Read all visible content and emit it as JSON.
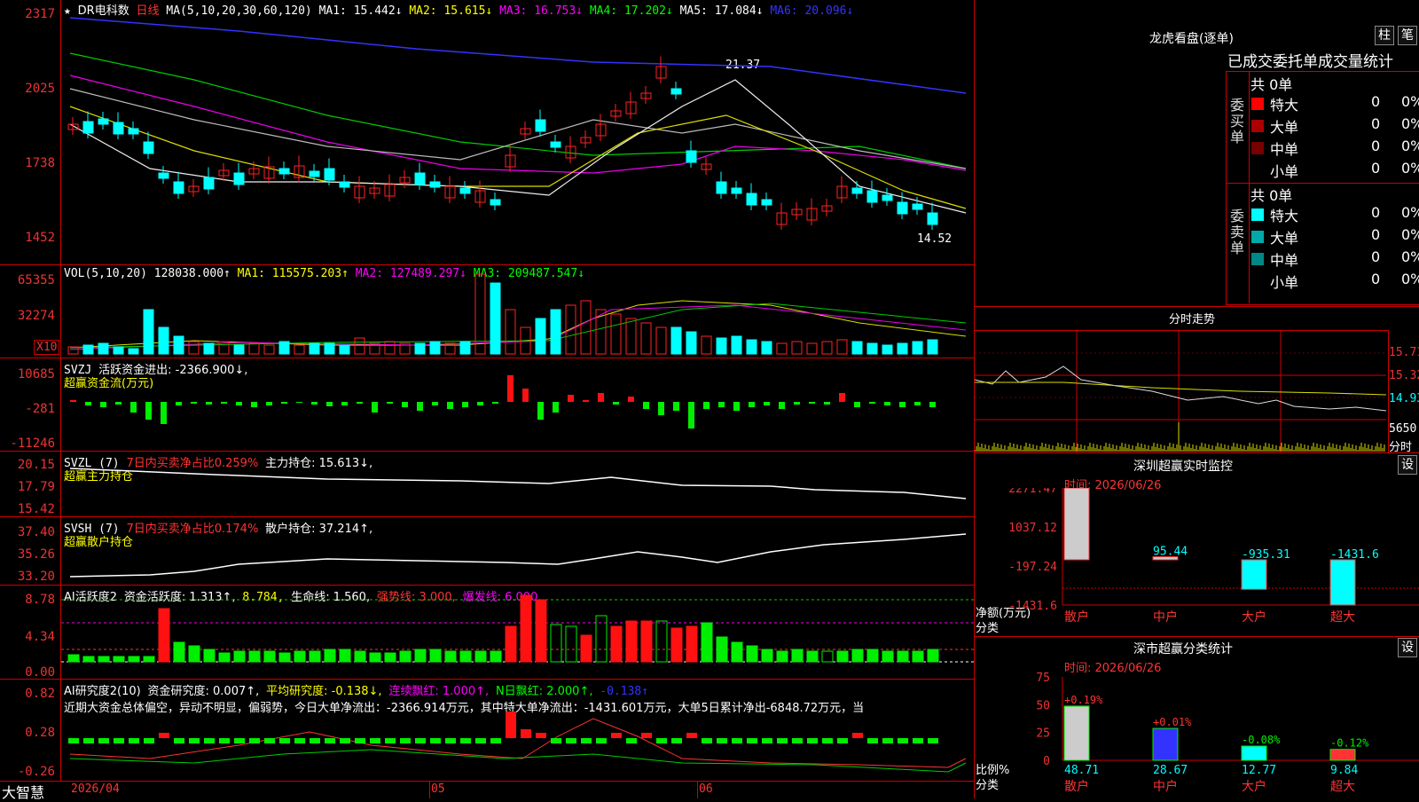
{
  "stock": {
    "name": "DR电科数",
    "period": "日线",
    "star": "★"
  },
  "ma": {
    "label": "MA(5,10,20,30,60,120)",
    "ma1": "MA1: 15.442↓",
    "ma2": "MA2: 15.615↓",
    "ma3": "MA3: 16.753↓",
    "ma4": "MA4: 17.202↓",
    "ma5": "MA5: 17.084↓",
    "ma6": "MA6: 20.096↓"
  },
  "price_axis": [
    "2317",
    "2025",
    "1738",
    "1452"
  ],
  "price_marks": {
    "high": "21.37",
    "low": "14.52"
  },
  "vol": {
    "label": "VOL(5,10,20)",
    "value": "128038.000↑",
    "ma1": "MA1: 115575.203↑",
    "ma2": "MA2: 127489.297↓",
    "ma3": "MA3: 209487.547↓",
    "axis": [
      "65355",
      "32274"
    ],
    "unit": "X10"
  },
  "svzj": {
    "name": "SVZJ",
    "desc": "活跃资金进出: -2366.900↓,",
    "sub": "超赢资金流(万元)",
    "axis": [
      "10685",
      "-281",
      "-11246"
    ]
  },
  "svzl": {
    "name": "SVZL (7)",
    "ratio": "7日内买卖净占比0.259%",
    "hold": "主力持仓: 15.613↓,",
    "sub": "超赢主力持仓",
    "axis": [
      "20.15",
      "17.79",
      "15.42"
    ]
  },
  "svsh": {
    "name": "SVSH (7)",
    "ratio": "7日内买卖净占比0.174%",
    "hold": "散户持仓: 37.214↑,",
    "sub": "超赢散户持仓",
    "axis": [
      "37.40",
      "35.26",
      "33.20"
    ]
  },
  "ai2": {
    "name": "AI活跃度2",
    "a": "资金活跃度: 1.313↑,",
    "b": "8.784,",
    "c": "生命线: 1.560,",
    "d": "强势线: 3.000,",
    "e": "爆发线: 6.000,",
    "axis": [
      "8.78",
      "4.34",
      "0.00"
    ]
  },
  "ai3": {
    "name": "AI研究度2(10)",
    "a": "资金研究度: 0.007↑,",
    "b": "平均研究度: -0.138↓,",
    "c": "连续飘红: 1.000↑,",
    "d": "N日飘红: 2.000↑,",
    "e": "-0.138↑",
    "note": "近期大资金总体偏空，异动不明显，偏弱势，今日大单净流出：-2366.914万元，其中特大单净流出：-1431.601万元，大单5日累计净出-6848.72万元，当",
    "axis": [
      "0.82",
      "0.28",
      "-0.26"
    ]
  },
  "bottom": {
    "brand": "大智慧",
    "d1": "2026/04",
    "d2": "05",
    "d3": "06"
  },
  "longhu": {
    "title": "龙虎看盘(逐单)",
    "btn1": "柱",
    "btn2": "笔",
    "tabs": "已成交委托单成交量统计",
    "buy": {
      "side": "委买单",
      "total": "共 0单",
      "rows": [
        {
          "k": "特大",
          "v": "0",
          "p": "0%",
          "c": "#f00"
        },
        {
          "k": "大单",
          "v": "0",
          "p": "0%",
          "c": "#a00"
        },
        {
          "k": "中单",
          "v": "0",
          "p": "0%",
          "c": "#700"
        },
        {
          "k": "小单",
          "v": "0",
          "p": "0%",
          "c": "#000"
        }
      ]
    },
    "sell": {
      "side": "委卖单",
      "total": "共 0单",
      "rows": [
        {
          "k": "特大",
          "v": "0",
          "p": "0%",
          "c": "#0ff"
        },
        {
          "k": "大单",
          "v": "0",
          "p": "0%",
          "c": "#0aa"
        },
        {
          "k": "中单",
          "v": "0",
          "p": "0%",
          "c": "#088"
        },
        {
          "k": "小单",
          "v": "0",
          "p": "0%",
          "c": "#000"
        }
      ]
    }
  },
  "fenshi": {
    "title": "分时走势",
    "axis": [
      "15.71",
      "15.32",
      "14.93",
      "5650"
    ],
    "unit": "分时"
  },
  "monitor": {
    "title": "深圳超赢实时监控",
    "btn": "设",
    "time": "时间: 2026/06/26",
    "axis": [
      "2271.47",
      "1037.12",
      "-197.24",
      "-1431.6"
    ],
    "ylabel": "净额(万元)",
    "xlabel": "分类",
    "cats": [
      "散户",
      "中户",
      "大户",
      "超大"
    ],
    "vals": [
      "2271.47",
      "95.44",
      "-935.31",
      "-1431.6"
    ]
  },
  "classify": {
    "title": "深市超赢分类统计",
    "btn": "设",
    "time": "时间: 2026/06/26",
    "axis": [
      "75",
      "50",
      "25",
      "0"
    ],
    "ylabel": "比例%",
    "xlabel": "分类",
    "cats": [
      "散户",
      "中户",
      "大户",
      "超大"
    ],
    "pct": [
      "+0.19%",
      "+0.01%",
      "-0.08%",
      "-0.12%"
    ],
    "vals": [
      "48.71",
      "28.67",
      "12.77",
      "9.84"
    ]
  },
  "chart_data": {
    "type": "bar",
    "title": "深圳超赢实时监控",
    "categories": [
      "散户",
      "中户",
      "大户",
      "超大"
    ],
    "series": [
      {
        "name": "净额(万元)",
        "values": [
          2271.47,
          95.44,
          -935.31,
          -1431.6
        ]
      }
    ],
    "ylim": [
      -1431.6,
      2271.47
    ]
  },
  "colors": {
    "up": "#ff2222",
    "down": "#00ffff",
    "grid": "#cc0000"
  }
}
